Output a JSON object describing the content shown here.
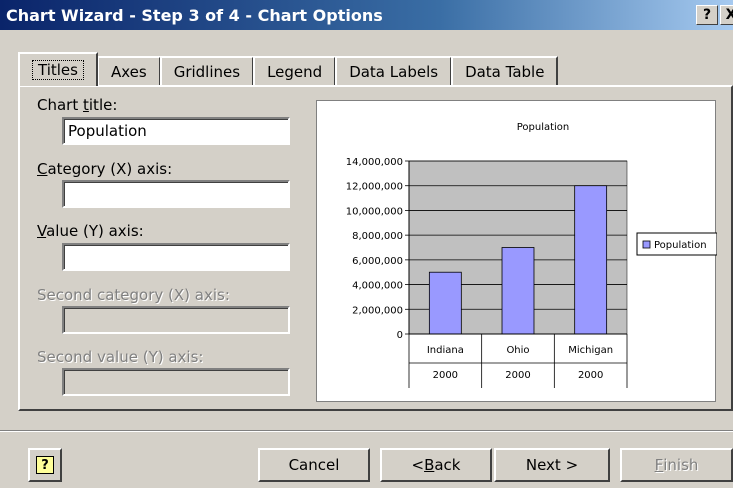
{
  "window": {
    "title": "Chart Wizard - Step 3 of 4 - Chart Options",
    "help_btn": "?",
    "close_btn": "X"
  },
  "tabs": [
    {
      "label": "Titles",
      "active": true
    },
    {
      "label": "Axes"
    },
    {
      "label": "Gridlines"
    },
    {
      "label": "Legend"
    },
    {
      "label": "Data Labels"
    },
    {
      "label": "Data Table"
    }
  ],
  "form": {
    "chart_title": {
      "label_pre": "Chart ",
      "label_key": "t",
      "label_post": "itle:",
      "value": "Population"
    },
    "category_axis": {
      "label_key": "C",
      "label_post": "ategory (X) axis:",
      "value": ""
    },
    "value_axis": {
      "label_key": "V",
      "label_post": "alue (Y) axis:",
      "value": ""
    },
    "second_category_axis": {
      "label": "Second category (X) axis:",
      "value": ""
    },
    "second_value_axis": {
      "label": "Second value (Y) axis:",
      "value": ""
    }
  },
  "chart_data": {
    "type": "bar",
    "title": "Population",
    "categories": [
      "Indiana",
      "Ohio",
      "Michigan"
    ],
    "category_sublabels": [
      "2000",
      "2000",
      "2000"
    ],
    "series": [
      {
        "name": "Population",
        "values": [
          5000000,
          7000000,
          12000000
        ]
      }
    ],
    "ylim": [
      0,
      14000000
    ],
    "yticks": [
      "14,000,000",
      "12,000,000",
      "10,000,000",
      "8,000,000",
      "6,000,000",
      "4,000,000",
      "2,000,000",
      "0"
    ],
    "plot_bg": "#c0c0c0",
    "bar_color": "#9999ff",
    "legend_position": "right",
    "gridlines": true
  },
  "buttons": {
    "help": "?",
    "cancel": "Cancel",
    "back_pre": "< ",
    "back_key": "B",
    "back_post": "ack",
    "next": "Next >",
    "finish_key": "F",
    "finish_post": "inish"
  }
}
